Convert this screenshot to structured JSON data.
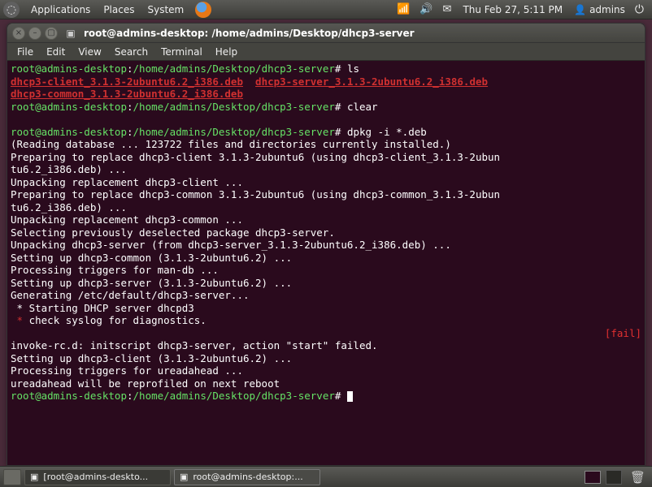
{
  "panel": {
    "apps": "Applications",
    "places": "Places",
    "system": "System",
    "clock": "Thu Feb 27,  5:11 PM",
    "user": "admins"
  },
  "window": {
    "title": "root@admins-desktop: /home/admins/Desktop/dhcp3-server",
    "menus": {
      "file": "File",
      "edit": "Edit",
      "view": "View",
      "search": "Search",
      "terminal": "Terminal",
      "help": "Help"
    }
  },
  "term": {
    "prompt_user": "root@admins-desktop",
    "prompt_sep": ":",
    "prompt_path": "/home/admins/Desktop/dhcp3-server",
    "prompt_end": "#",
    "ls_cmd": "ls",
    "file1": "dhcp3-client_3.1.3-2ubuntu6.2_i386.deb",
    "file2": "dhcp3-server_3.1.3-2ubuntu6.2_i386.deb",
    "file3": "dhcp3-common_3.1.3-2ubuntu6.2_i386.deb",
    "clear_cmd": "clear",
    "dpkg_cmd": "dpkg -i *.deb",
    "l1": "(Reading database ... 123722 files and directories currently installed.)",
    "l2a": "Preparing to replace dhcp3-client 3.1.3-2ubuntu6 (using dhcp3-client_3.1.3-2ubun",
    "l2b": "tu6.2_i386.deb) ...",
    "l3": "Unpacking replacement dhcp3-client ...",
    "l4a": "Preparing to replace dhcp3-common 3.1.3-2ubuntu6 (using dhcp3-common_3.1.3-2ubun",
    "l4b": "tu6.2_i386.deb) ...",
    "l5": "Unpacking replacement dhcp3-common ...",
    "l6": "Selecting previously deselected package dhcp3-server.",
    "l7": "Unpacking dhcp3-server (from dhcp3-server_3.1.3-2ubuntu6.2_i386.deb) ...",
    "l8": "Setting up dhcp3-common (3.1.3-2ubuntu6.2) ...",
    "l9": "Processing triggers for man-db ...",
    "l10": "Setting up dhcp3-server (3.1.3-2ubuntu6.2) ...",
    "l11": "Generating /etc/default/dhcp3-server...",
    "l12": " * Starting DHCP server dhcpd3",
    "l13": " * ",
    "l13b": "check syslog for diagnostics.",
    "fail": "[fail]",
    "l14": "invoke-rc.d: initscript dhcp3-server, action \"start\" failed.",
    "l15": "Setting up dhcp3-client (3.1.3-2ubuntu6.2) ...",
    "l16": "Processing triggers for ureadahead ...",
    "l17": "ureadahead will be reprofiled on next reboot"
  },
  "taskbar": {
    "task1": "[root@admins-deskto...",
    "task2": "root@admins-desktop:..."
  }
}
